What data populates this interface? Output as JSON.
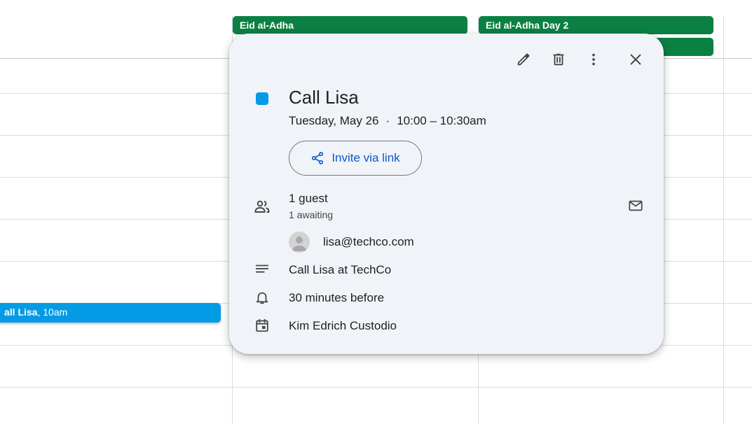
{
  "allday_events": [
    {
      "label": "Eid al-Adha",
      "color": "#0b8043"
    },
    {
      "label": "Eid al-Adha Day 2",
      "color": "#0b8043"
    }
  ],
  "timed_event": {
    "title": "all Lisa",
    "time": "10am",
    "separator": ", ",
    "color": "#039be5"
  },
  "popup": {
    "toolbar": {
      "edit": "pencil-icon",
      "delete": "trash-icon",
      "more": "more-vert-icon",
      "close": "close-icon"
    },
    "event_color": "#039be5",
    "title": "Call Lisa",
    "date": "Tuesday, May 26",
    "dot": "·",
    "time": "10:00 – 10:30am",
    "invite_label": "Invite via link",
    "guests": {
      "count_label": "1 guest",
      "status_label": "1 awaiting"
    },
    "guest_email": "lisa@techco.com",
    "description": "Call Lisa at TechCo",
    "reminder": "30 minutes before",
    "calendar_owner": "Kim Edrich Custodio"
  },
  "colors": {
    "accent": "#0b57d0",
    "card_bg": "#f0f4f9",
    "grid": "#dadce0"
  }
}
